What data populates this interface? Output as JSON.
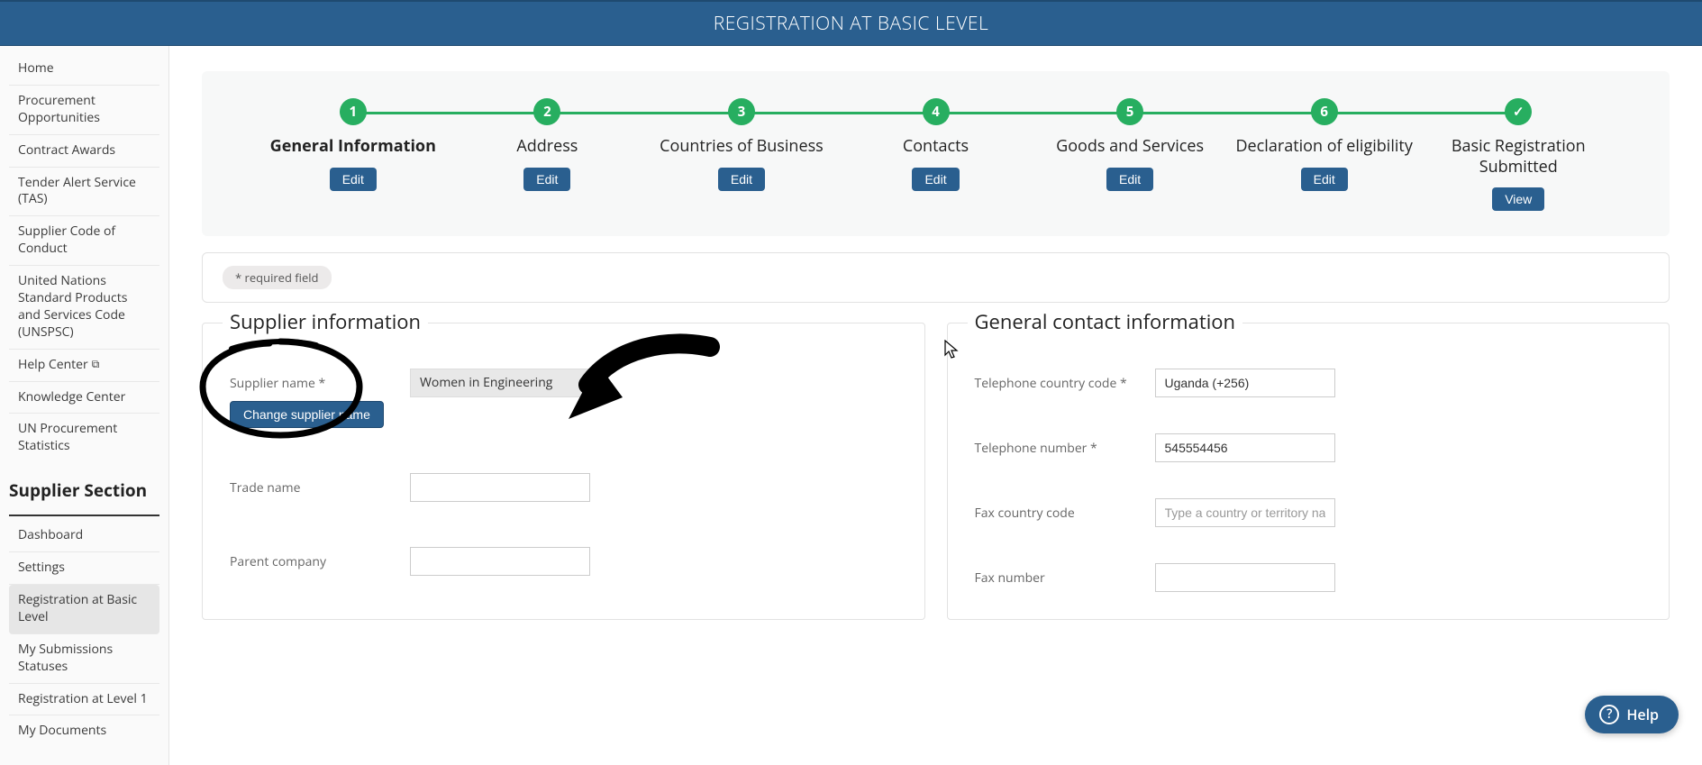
{
  "header": {
    "title": "REGISTRATION AT BASIC LEVEL"
  },
  "sidebar": {
    "main_nav": [
      {
        "label": "Home"
      },
      {
        "label": "Procurement Opportunities"
      },
      {
        "label": "Contract Awards"
      },
      {
        "label": "Tender Alert Service (TAS)"
      },
      {
        "label": "Supplier Code of Conduct"
      },
      {
        "label": "United Nations Standard Products and Services Code (UNSPSC)"
      },
      {
        "label": "Help Center",
        "external": true
      },
      {
        "label": "Knowledge Center"
      },
      {
        "label": "UN Procurement Statistics"
      }
    ],
    "section_title": "Supplier Section",
    "supplier_nav": [
      {
        "label": "Dashboard"
      },
      {
        "label": "Settings"
      },
      {
        "label": "Registration at Basic Level",
        "active": true
      },
      {
        "label": "My Submissions Statuses"
      },
      {
        "label": "Registration at Level 1"
      },
      {
        "label": "My Documents"
      }
    ]
  },
  "stepper": {
    "steps": [
      {
        "num": "1",
        "label": "General Information",
        "button": "Edit",
        "active": true
      },
      {
        "num": "2",
        "label": "Address",
        "button": "Edit"
      },
      {
        "num": "3",
        "label": "Countries of Business",
        "button": "Edit"
      },
      {
        "num": "4",
        "label": "Contacts",
        "button": "Edit"
      },
      {
        "num": "5",
        "label": "Goods and Services",
        "button": "Edit"
      },
      {
        "num": "6",
        "label": "Declaration of eligibility",
        "button": "Edit"
      },
      {
        "num": "✓",
        "label": "Basic Registration Submitted",
        "button": "View",
        "check": true
      }
    ]
  },
  "required_note": "* required field",
  "supplier_info": {
    "legend": "Supplier information",
    "supplier_name_label": "Supplier name *",
    "supplier_name_value": "Women in Engineering",
    "change_button": "Change supplier name",
    "trade_name_label": "Trade name",
    "trade_name_value": "",
    "parent_company_label": "Parent company",
    "parent_company_value": ""
  },
  "contact_info": {
    "legend": "General contact information",
    "tel_code_label": "Telephone country code *",
    "tel_code_value": "Uganda (+256)",
    "tel_num_label": "Telephone number *",
    "tel_num_value": "545554456",
    "fax_code_label": "Fax country code",
    "fax_code_placeholder": "Type a country or territory name",
    "fax_num_label": "Fax number",
    "fax_num_value": ""
  },
  "help": {
    "label": "Help"
  }
}
